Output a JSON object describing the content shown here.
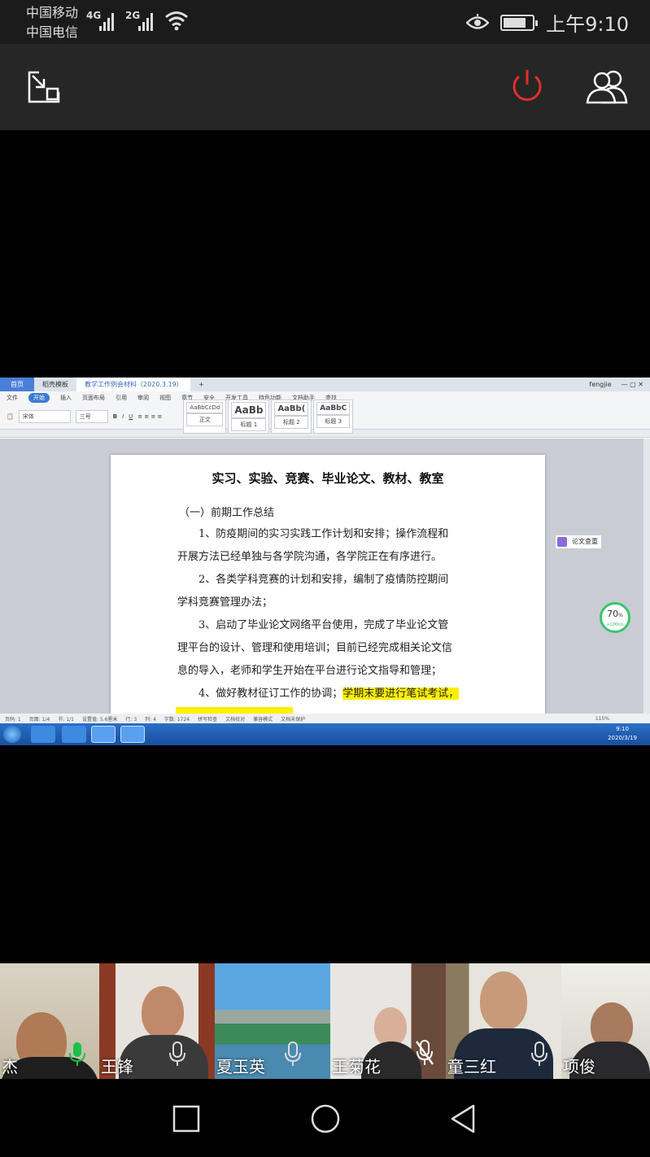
{
  "status_bar": {
    "carrier_1": "中国移动",
    "carrier_2": "中国电信",
    "network_1": "4G",
    "network_2": "2G",
    "time": "上午9:10"
  },
  "shared_screen": {
    "tabs": [
      "首页",
      "稻壳模板",
      "教学工作例会材料（2020.3.19）"
    ],
    "user": "fengjie",
    "menu": [
      "文件",
      "开始",
      "插入",
      "页面布局",
      "引用",
      "审阅",
      "视图",
      "章节",
      "安全",
      "开发工具",
      "特色功能",
      "文档助手",
      "查找"
    ],
    "menu_active": "开始",
    "font_name": "宋体",
    "font_size": "三号",
    "styles": [
      {
        "sample": "AaBbCcDd",
        "label": "正文"
      },
      {
        "sample": "AaBb",
        "label": "标题 1"
      },
      {
        "sample": "AaBb(",
        "label": "标题 2"
      },
      {
        "sample": "AaBbC",
        "label": "标题 3"
      }
    ],
    "side_panel_label": "论文查重",
    "gauge_value": "70",
    "gauge_unit": "%",
    "gauge_speed": "+106K/s",
    "document": {
      "title": "实习、实验、竞赛、毕业论文、教材、教室",
      "subtitle": "（一）前期工作总结",
      "lines": [
        "1、防疫期间的实习实践工作计划和安排；操作流程和",
        "开展方法已经单独与各学院沟通，各学院正在有序进行。",
        "2、各类学科竞赛的计划和安排，编制了疫情防控期间",
        "学科竞赛管理办法；",
        "3、启动了毕业论文网络平台使用，完成了毕业论文管",
        "理平台的设计、管理和使用培训；目前已经完成相关论文信",
        "息的导入，老师和学生开始在平台进行论文指导和管理；"
      ],
      "line_last_plain": "4、做好教材征订工作的协调；",
      "line_last_highlight": "学期末要进行笔试考试，"
    },
    "status": {
      "page": "页码: 1",
      "pages": "页面: 1/4",
      "section": "节: 1/1",
      "setting": "设置值: 5.6厘米",
      "row": "行: 3",
      "col": "列: 4",
      "words": "字数: 1724",
      "spell": "拼写检查",
      "proof": "文档校对",
      "compat": "兼容模式",
      "protect": "文档未保护",
      "zoom": "115%"
    },
    "taskbar_time": "9:10",
    "taskbar_date": "2020/3/19"
  },
  "participants": [
    {
      "name": "杰",
      "mic": "on"
    },
    {
      "name": "王锋",
      "mic": "off"
    },
    {
      "name": "夏玉英",
      "mic": "off"
    },
    {
      "name": "王菊花",
      "mic": "muted"
    },
    {
      "name": "童三红",
      "mic": "off"
    },
    {
      "name": "项俊",
      "mic": "off"
    }
  ],
  "colors": {
    "end_call": "#e0302a",
    "mic_active": "#19c14a",
    "highlight": "#ffef00"
  }
}
